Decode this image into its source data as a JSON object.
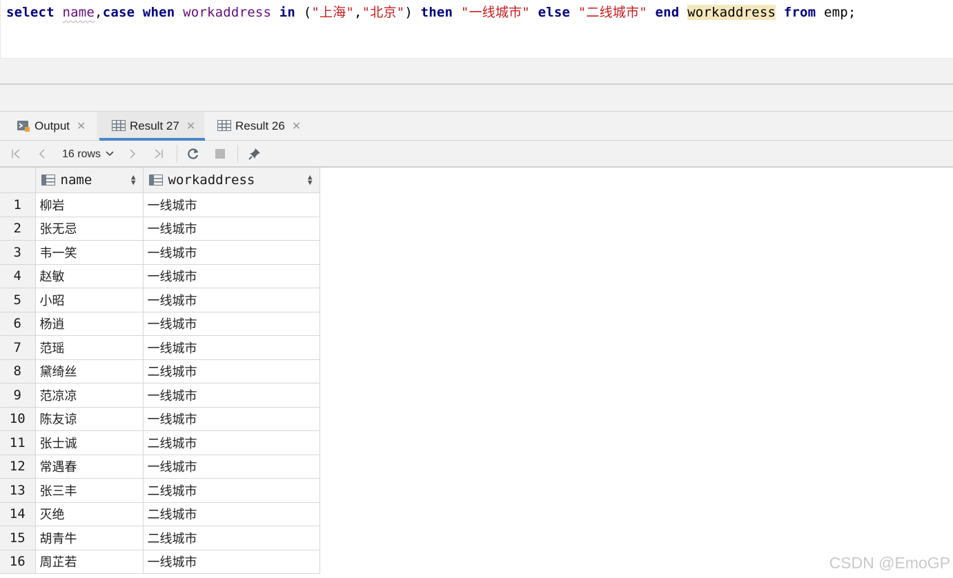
{
  "editor": {
    "sql": {
      "kw_select": "select",
      "id_name": "name",
      "comma": ",",
      "kw_case": "case",
      "kw_when": "when",
      "id_workaddress": "workaddress",
      "kw_in": "in",
      "paren_open": "(",
      "str_shanghai": "\"上海\"",
      "comma2": ",",
      "str_beijing": "\"北京\"",
      "paren_close": ")",
      "kw_then": "then",
      "str_tier1": "\"一线城市\"",
      "kw_else": "else",
      "str_tier2": "\"二线城市\"",
      "kw_end": "end",
      "alias": "workaddress",
      "kw_from": "from",
      "table": "emp;"
    }
  },
  "tabs": [
    {
      "label": "Output",
      "icon": "console-icon"
    },
    {
      "label": "Result 27",
      "icon": "table-icon",
      "active": true
    },
    {
      "label": "Result 26",
      "icon": "table-icon"
    }
  ],
  "toolbar": {
    "rows_label": "16 rows",
    "buttons": [
      "first-page-icon",
      "prev-page-icon",
      "next-page-icon",
      "last-page-icon",
      "refresh-icon",
      "stop-icon",
      "pin-icon"
    ]
  },
  "grid": {
    "columns": [
      "name",
      "workaddress"
    ],
    "rows": [
      {
        "n": "1",
        "name": "柳岩",
        "workaddress": "一线城市"
      },
      {
        "n": "2",
        "name": "张无忌",
        "workaddress": "一线城市"
      },
      {
        "n": "3",
        "name": "韦一笑",
        "workaddress": "一线城市"
      },
      {
        "n": "4",
        "name": "赵敏",
        "workaddress": "一线城市"
      },
      {
        "n": "5",
        "name": "小昭",
        "workaddress": "一线城市"
      },
      {
        "n": "6",
        "name": "杨逍",
        "workaddress": "一线城市"
      },
      {
        "n": "7",
        "name": "范瑶",
        "workaddress": "一线城市"
      },
      {
        "n": "8",
        "name": "黛绮丝",
        "workaddress": "二线城市"
      },
      {
        "n": "9",
        "name": "范凉凉",
        "workaddress": "一线城市"
      },
      {
        "n": "10",
        "name": "陈友谅",
        "workaddress": "一线城市"
      },
      {
        "n": "11",
        "name": "张士诚",
        "workaddress": "二线城市"
      },
      {
        "n": "12",
        "name": "常遇春",
        "workaddress": "一线城市"
      },
      {
        "n": "13",
        "name": "张三丰",
        "workaddress": "二线城市"
      },
      {
        "n": "14",
        "name": "灭绝",
        "workaddress": "二线城市"
      },
      {
        "n": "15",
        "name": "胡青牛",
        "workaddress": "二线城市"
      },
      {
        "n": "16",
        "name": "周芷若",
        "workaddress": "一线城市"
      }
    ]
  },
  "watermark": "CSDN @EmoGP",
  "colors": {
    "keyword": "#000080",
    "identifier": "#660e7a",
    "string": "#c81e1e",
    "highlight": "#f6e8bd",
    "active_tab_underline": "#4a86c8"
  }
}
